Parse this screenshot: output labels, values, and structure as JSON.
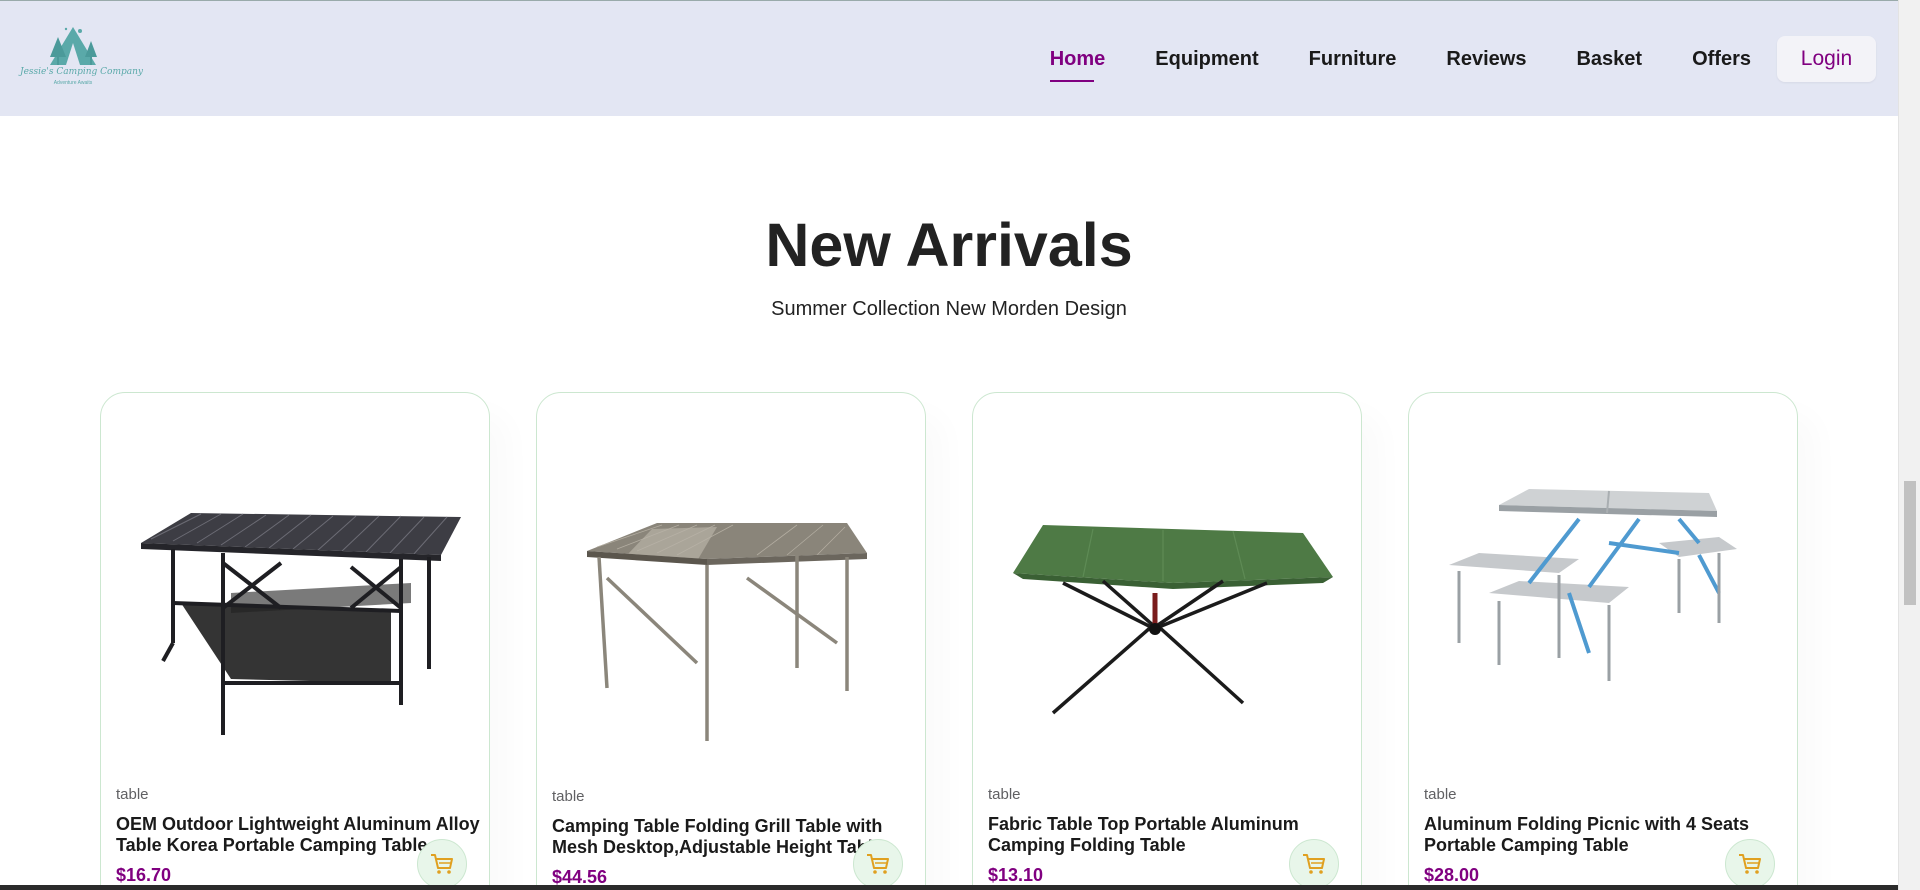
{
  "brand": {
    "logo_text": "Jessie's Camping Company",
    "logo_tagline": "Adventure Awaits",
    "accent_color": "#800080",
    "nav_bg": "#e3e6f3"
  },
  "nav": {
    "items": [
      {
        "label": "Home",
        "active": true
      },
      {
        "label": "Equipment",
        "active": false
      },
      {
        "label": "Furniture",
        "active": false
      },
      {
        "label": "Reviews",
        "active": false
      },
      {
        "label": "Basket",
        "active": false
      },
      {
        "label": "Offers",
        "active": false
      }
    ],
    "login_label": "Login"
  },
  "section": {
    "title": "New Arrivals",
    "subtitle": "Summer Collection New Morden Design"
  },
  "products": [
    {
      "category": "table",
      "name": "OEM Outdoor Lightweight Aluminum Alloy Table Korea Portable Camping Table",
      "price": "$16.70",
      "image_icon": "roll-top-table-image",
      "cart_icon": "cart-icon"
    },
    {
      "category": "table",
      "name": "Camping Table Folding Grill Table with Mesh Desktop,Adjustable Height Table",
      "price": "$44.56",
      "image_icon": "mesh-grill-table-image",
      "cart_icon": "cart-icon"
    },
    {
      "category": "table",
      "name": "Fabric Table Top Portable Aluminum Camping Folding Table",
      "price": "$13.10",
      "image_icon": "fabric-table-image",
      "cart_icon": "cart-icon"
    },
    {
      "category": "table",
      "name": "Aluminum Folding Picnic with 4 Seats Portable Camping Table",
      "price": "$28.00",
      "image_icon": "picnic-table-image",
      "cart_icon": "cart-icon"
    }
  ]
}
